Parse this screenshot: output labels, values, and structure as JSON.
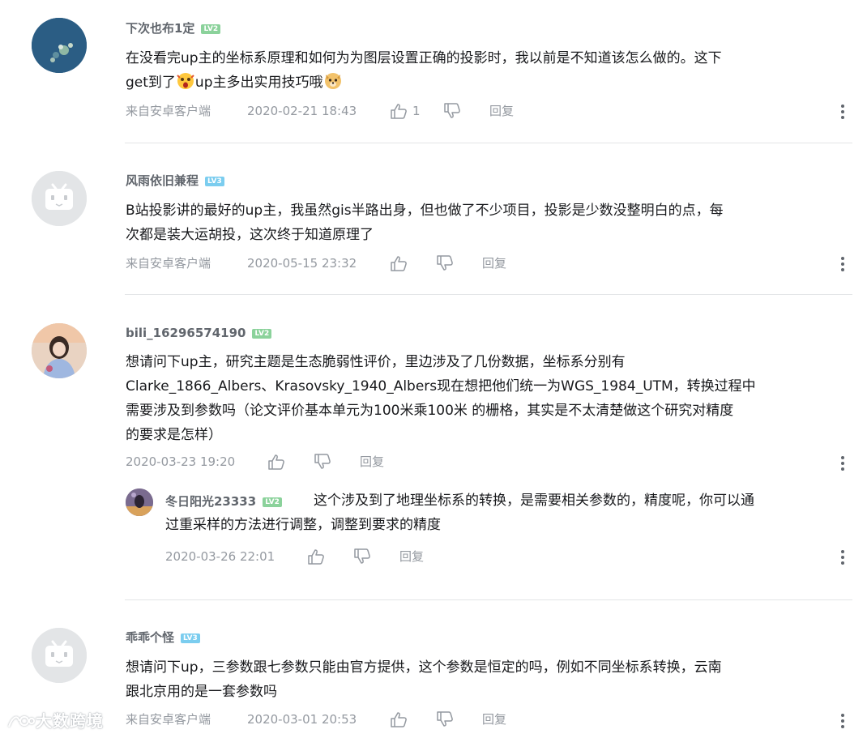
{
  "comments": [
    {
      "user": "下次也布1定",
      "level": "LV2",
      "text_a": "在没看完up主的坐标系原理和如何为为图层设置正确的投影时，我以前是不知道该怎么做的。这下\nget到了",
      "text_b": "up主多出实用技巧哦",
      "emoji_a": "shocked-emoji",
      "emoji_b": "doge-emoji",
      "source": "来自安卓客户端",
      "time": "2020-02-21 18:43",
      "likes": "1",
      "reply": "回复"
    },
    {
      "user": "风雨依旧兼程",
      "level": "LV3",
      "text": "B站投影讲的最好的up主，我虽然gis半路出身，但也做了不少项目，投影是少数没整明白的点，每\n次都是装大运胡投，这次终于知道原理了",
      "source": "来自安卓客户端",
      "time": "2020-05-15 23:32",
      "reply": "回复"
    },
    {
      "user": "bili_16296574190",
      "level": "LV2",
      "text": "想请问下up主，研究主题是生态脆弱性评价，里边涉及了几份数据，坐标系分别有\nClarke_1866_Albers、Krasovsky_1940_Albers现在想把他们统一为WGS_1984_UTM，转换过程中\n需要涉及到参数吗（论文评价基本单元为100米乘100米 的栅格，其实是不太清楚做这个研究对精度\n的要求是怎样）",
      "time": "2020-03-23 19:20",
      "reply": "回复",
      "sub_reply": {
        "user": "冬日阳光23333",
        "level": "LV2",
        "text": "这个涉及到了地理坐标系的转换，是需要相关参数的，精度呢，你可以通\n过重采样的方法进行调整，调整到要求的精度",
        "time": "2020-03-26 22:01",
        "reply": "回复"
      }
    },
    {
      "user": "乖乖个怪",
      "level": "LV3",
      "text": "想请问下up，三参数跟七参数只能由官方提供，这个参数是恒定的吗，例如不同坐标系转换，云南\n跟北京用的是一套参数吗",
      "source": "来自安卓客户端",
      "time": "2020-03-01 20:53",
      "reply": "回复"
    }
  ],
  "watermark": "大数跨境",
  "colors": {
    "username": "#61666d",
    "meta": "#9499a0",
    "level2": "#8bd29b",
    "level3": "#7bcdef",
    "divider": "#e3e5e7"
  }
}
